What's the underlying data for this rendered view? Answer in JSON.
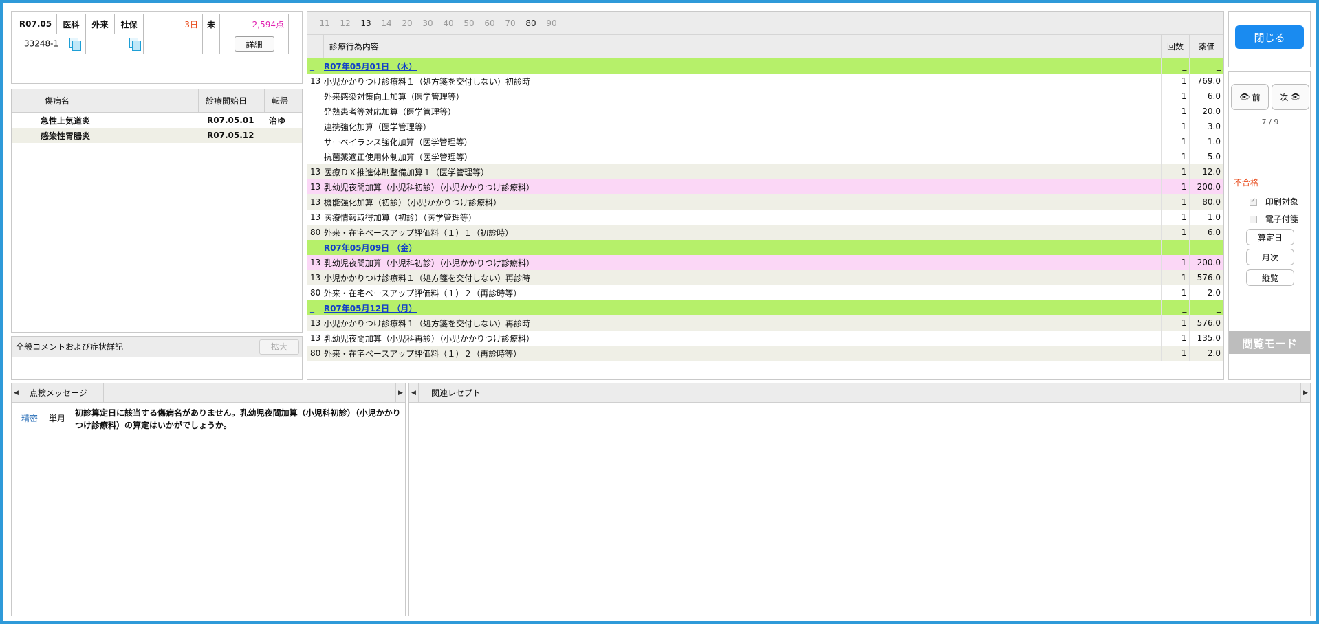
{
  "header": {
    "date": "R07.05",
    "department": "医科",
    "visit_type": "外来",
    "insurance": "社保",
    "days": "3日",
    "status": "未",
    "points": "2,594点",
    "patient_id": "33248-1",
    "detail_button": "詳細"
  },
  "diseases": {
    "columns": [
      "傷病名",
      "診療開始日",
      "転帰"
    ],
    "rows": [
      {
        "name": "急性上気道炎",
        "start": "R07.05.01",
        "outcome": "治ゆ"
      },
      {
        "name": "感染性胃腸炎",
        "start": "R07.05.12",
        "outcome": ""
      }
    ]
  },
  "comment": {
    "label": "全般コメントおよび症状詳記",
    "expand_button": "拡大"
  },
  "detail": {
    "day_tabs": [
      "11",
      "12",
      "13",
      "14",
      "20",
      "30",
      "40",
      "50",
      "60",
      "70",
      "80",
      "90"
    ],
    "active_day_tabs": [
      "13",
      "80"
    ],
    "columns": [
      "診療行為内容",
      "回数",
      "薬価"
    ],
    "rows": [
      {
        "type": "date",
        "code": "_",
        "text": "R07年05月01日 （木）",
        "count": "_",
        "price": "_"
      },
      {
        "type": "white",
        "code": "13",
        "text": "小児かかりつけ診療料１（処方箋を交付しない）初診時",
        "count": "1",
        "price": "769.0"
      },
      {
        "type": "white",
        "code": "",
        "text": "外来感染対策向上加算（医学管理等）",
        "count": "1",
        "price": "6.0"
      },
      {
        "type": "white",
        "code": "",
        "text": "発熱患者等対応加算（医学管理等）",
        "count": "1",
        "price": "20.0"
      },
      {
        "type": "white",
        "code": "",
        "text": "連携強化加算（医学管理等）",
        "count": "1",
        "price": "3.0"
      },
      {
        "type": "white",
        "code": "",
        "text": "サーベイランス強化加算（医学管理等）",
        "count": "1",
        "price": "1.0"
      },
      {
        "type": "white",
        "code": "",
        "text": "抗菌薬適正使用体制加算（医学管理等）",
        "count": "1",
        "price": "5.0"
      },
      {
        "type": "gray",
        "code": "13",
        "text": "医療ＤＸ推進体制整備加算１（医学管理等）",
        "count": "1",
        "price": "12.0"
      },
      {
        "type": "pink",
        "code": "13",
        "text": "乳幼児夜間加算（小児科初診）（小児かかりつけ診療料）",
        "count": "1",
        "price": "200.0"
      },
      {
        "type": "gray",
        "code": "13",
        "text": "機能強化加算（初診）（小児かかりつけ診療料）",
        "count": "1",
        "price": "80.0"
      },
      {
        "type": "white",
        "code": "13",
        "text": "医療情報取得加算（初診）（医学管理等）",
        "count": "1",
        "price": "1.0"
      },
      {
        "type": "gray",
        "code": "80",
        "text": "外来・在宅ベースアップ評価料（１）１（初診時）",
        "count": "1",
        "price": "6.0"
      },
      {
        "type": "date",
        "code": "_",
        "text": "R07年05月09日 （金）",
        "count": "_",
        "price": "_"
      },
      {
        "type": "pink",
        "code": "13",
        "text": "乳幼児夜間加算（小児科初診）（小児かかりつけ診療料）",
        "count": "1",
        "price": "200.0"
      },
      {
        "type": "gray",
        "code": "13",
        "text": "小児かかりつけ診療料１（処方箋を交付しない）再診時",
        "count": "1",
        "price": "576.0"
      },
      {
        "type": "white",
        "code": "80",
        "text": "外来・在宅ベースアップ評価料（１）２（再診時等）",
        "count": "1",
        "price": "2.0"
      },
      {
        "type": "date",
        "code": "_",
        "text": "R07年05月12日 （月）",
        "count": "_",
        "price": "_"
      },
      {
        "type": "gray",
        "code": "13",
        "text": "小児かかりつけ診療料１（処方箋を交付しない）再診時",
        "count": "1",
        "price": "576.0"
      },
      {
        "type": "white",
        "code": "13",
        "text": "乳幼児夜間加算（小児科再診）（小児かかりつけ診療料）",
        "count": "1",
        "price": "135.0"
      },
      {
        "type": "gray",
        "code": "80",
        "text": "外来・在宅ベースアップ評価料（１）２（再診時等）",
        "count": "1",
        "price": "2.0"
      }
    ]
  },
  "side": {
    "close_button": "閉じる",
    "prev_button": "前",
    "next_button": "次",
    "page_counter": "7 / 9",
    "result": "不合格",
    "print_target": "印刷対象",
    "e_prescription": "電子付箋",
    "calc_day_button": "算定日",
    "monthly_button": "月次",
    "list_button": "縦覧",
    "mode": "閲覧モード"
  },
  "messages": {
    "tab": "点検メッセージ",
    "items": [
      {
        "level": "精密",
        "scope": "単月",
        "text": "初診算定日に該当する傷病名がありません。乳幼児夜間加算（小児科初診）（小児かかりつけ診療料）の算定はいかがでしょうか。"
      }
    ]
  },
  "related": {
    "tab": "関連レセプト"
  },
  "colors": {
    "frame": "#2f9ad9",
    "date_row": "#b6f06a",
    "pink_row": "#fbd7f6",
    "alt_row": "#efefe6",
    "points": "#e020b0",
    "days": "#e84a1a",
    "fail": "#e84a1a",
    "close_button": "#1a8bf0"
  }
}
